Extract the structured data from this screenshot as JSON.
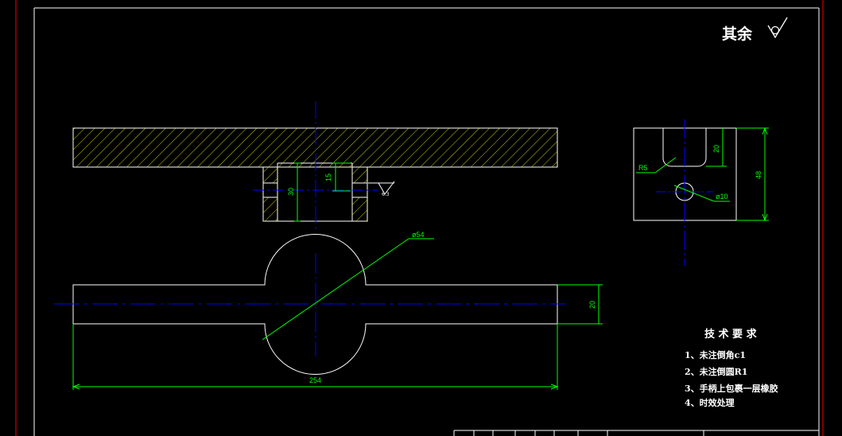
{
  "colors": {
    "background": "#000000",
    "outline": "#ffffff",
    "dimension": "#00ff00",
    "centerline": "#0000ff",
    "frame_red": "#ff0000",
    "hatch": "#ffff00"
  },
  "surface_note": {
    "text": "其余"
  },
  "dimensions": {
    "hole_depth": "15",
    "hub_height": "30",
    "roughness_value": "6.3",
    "bulb_dia": "ø54",
    "bar_width": "20",
    "total_length": "254",
    "slot_depth": "20",
    "end_height": "48",
    "slot_radius": "R5",
    "pin_hole_dia": "ø10"
  },
  "tech_requirements": {
    "title": "技 术 要 求",
    "items": [
      "1、未注倒角c1",
      "2、未注倒圆R1",
      "3、手柄上包裹一层橡胶",
      "4、时效处理"
    ]
  }
}
